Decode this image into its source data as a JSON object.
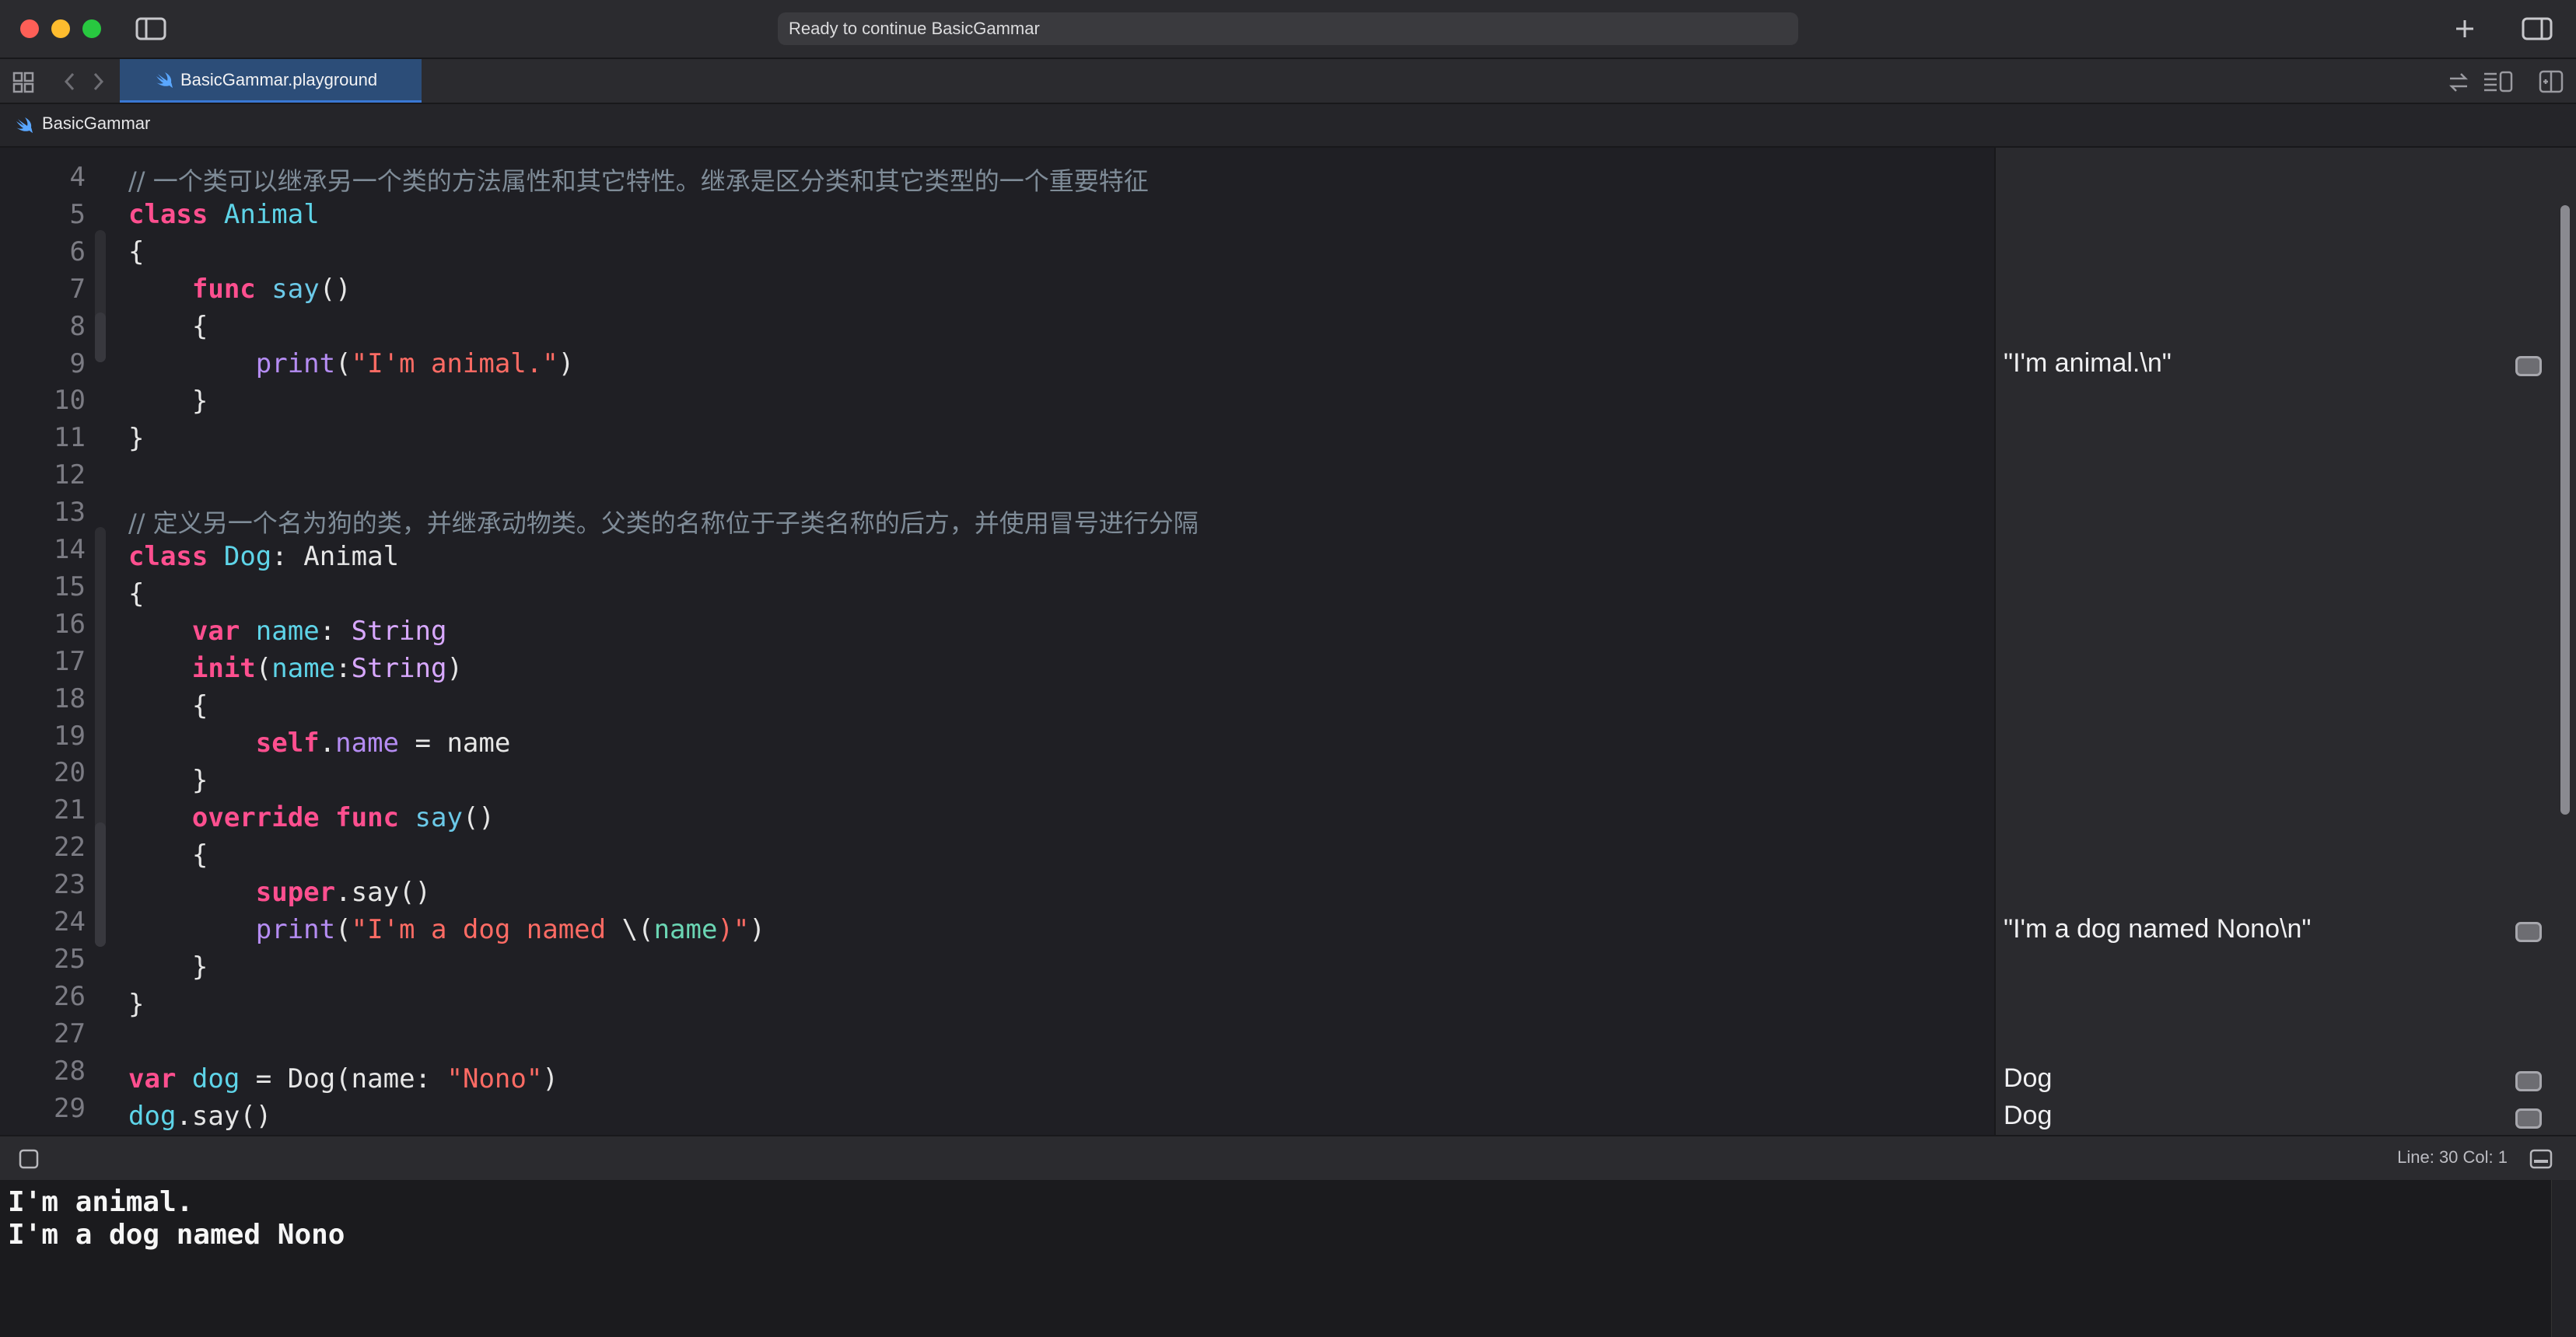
{
  "window": {
    "activity_status": "Ready to continue BasicGammar",
    "tab_label": "BasicGammar.playground",
    "breadcrumb": "BasicGammar"
  },
  "editor": {
    "line_numbers": [
      "4",
      "5",
      "6",
      "7",
      "8",
      "9",
      "10",
      "11",
      "12",
      "13",
      "14",
      "15",
      "16",
      "17",
      "18",
      "19",
      "20",
      "21",
      "22",
      "23",
      "24",
      "25",
      "26",
      "27",
      "28",
      "29"
    ],
    "comment_line_4": "// 一个类可以继承另一个类的方法属性和其它特性。继承是区分类和其它类型的一个重要特征",
    "comment_line_13": "// 定义另一个名为狗的类，并继承动物类。父类的名称位于子类名称的后方，并使用冒号进行分隔",
    "tokens": {
      "class_kw": "class",
      "animal": "Animal",
      "dog_type": "Dog",
      "func_kw": "func",
      "say": "say",
      "parens": "()",
      "open_brace": "{",
      "close_brace": "}",
      "print": "print",
      "str_animal": "\"I'm animal.\"",
      "var_kw": "var",
      "name": "name",
      "string_type": "String",
      "init": "init",
      "self_kw": "self",
      "override_kw": "override",
      "super_kw": "super",
      "str_dog_prefix": "\"I'm a dog named ",
      "str_interp_open": "\\(",
      "str_dog_suffix": ")\"",
      "dog_var": "dog",
      "str_nono": "\"Nono\""
    }
  },
  "results_sidebar": {
    "line9": "\"I'm animal.\\n\"",
    "line24": "\"I'm a dog named Nono\\n\"",
    "line28": "Dog",
    "line29": "Dog"
  },
  "status": {
    "line_col": "Line: 30  Col: 1"
  },
  "console": {
    "lines": [
      "I'm animal.",
      "I'm a dog named Nono"
    ]
  },
  "colors": {
    "keyword": "#ff4f8f",
    "type": "#5ed4e8",
    "string": "#ff6b64",
    "comment": "#7f8c98",
    "accent_tab": "#2c4d78"
  },
  "icons": [
    "sidebar-toggle-icon",
    "plus-icon",
    "inspector-toggle-icon",
    "grid-icon",
    "back-icon",
    "forward-icon",
    "swift-icon",
    "refresh-icon",
    "lines-icon",
    "add-editor-icon",
    "console-toggle-icon",
    "quicklook-icon"
  ]
}
